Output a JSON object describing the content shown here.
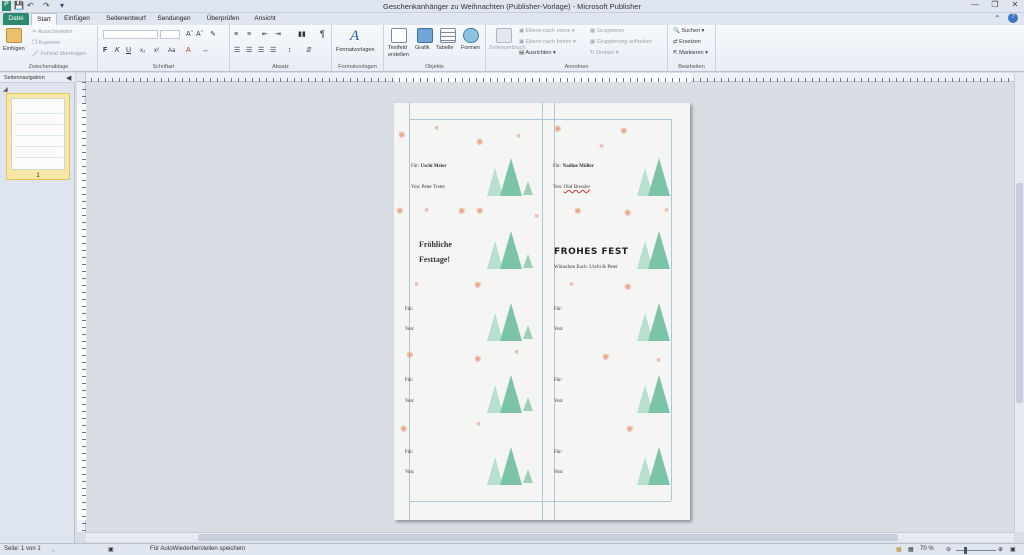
{
  "titlebar": {
    "title": "Geschenkanhänger zu Weihnachten (Publisher-Vorlage) - Microsoft Publisher",
    "app_icon": "publisher-icon",
    "quick_access": [
      "save-icon",
      "undo-icon",
      "redo-icon",
      "customize-icon"
    ]
  },
  "tabs": [
    "Datei",
    "Start",
    "Einfügen",
    "Seitenentwurf",
    "Sendungen",
    "Überprüfen",
    "Ansicht"
  ],
  "ribbon": {
    "clipboard": {
      "label": "Zwischenablage",
      "paste": "Einfügen",
      "cut": "Ausschneiden",
      "copy": "Kopieren",
      "format_painter": "Format übertragen"
    },
    "font": {
      "label": "Schriftart",
      "buttons": [
        "F",
        "K",
        "U",
        "x₂",
        "x²",
        "Aa"
      ]
    },
    "paragraph": {
      "label": "Absatz"
    },
    "styles": {
      "label": "Formatvorlagen",
      "button": "Formatvorlagen"
    },
    "objects": {
      "label": "Objekte",
      "draw_textbox": "Textfeld erstellen",
      "picture": "Grafik",
      "table": "Tabelle",
      "shapes": "Formen"
    },
    "arrange": {
      "label": "Anordnen",
      "wrap_text": "Zeilenumbruch",
      "bring_forward": "Ebene nach vorne",
      "send_backward": "Ebene nach hinten",
      "align": "Ausrichten",
      "group": "Gruppieren",
      "ungroup": "Gruppierung aufheben",
      "rotate": "Drehen"
    },
    "editing": {
      "label": "Bearbeiten",
      "find": "Suchen",
      "replace": "Ersetzen",
      "select": "Markieren"
    }
  },
  "pages_pane": {
    "title": "Seitennavigation",
    "page_number": "1"
  },
  "page": {
    "card1_for": "Für:",
    "card1_for_name": "Uschi Meier",
    "card1_from": "Von:",
    "card1_from_name": "Peter Treter",
    "card2_for": "Für:",
    "card2_for_name": "Nadine Müller",
    "card2_from": "Von:",
    "card2_from_name": "Olaf Bressler",
    "greeting_line1": "Fröhliche",
    "greeting_line2": "Festtage!",
    "frohes_fest": "FROHES FEST",
    "wish_line": "Wünschen Euch: Uschi & Peter",
    "for_label": "Für:",
    "from_label": "Von:"
  },
  "statusbar": {
    "page": "Seite: 1 von 1",
    "autosave": "Für AutoWiederherstellen speichern",
    "zoom": "70 %"
  },
  "colors": {
    "file_tab": "#2b8a6e",
    "tree": "#7cc4a8",
    "spark": "#e8a58c",
    "thumb_highlight": "#f7e7a6"
  }
}
